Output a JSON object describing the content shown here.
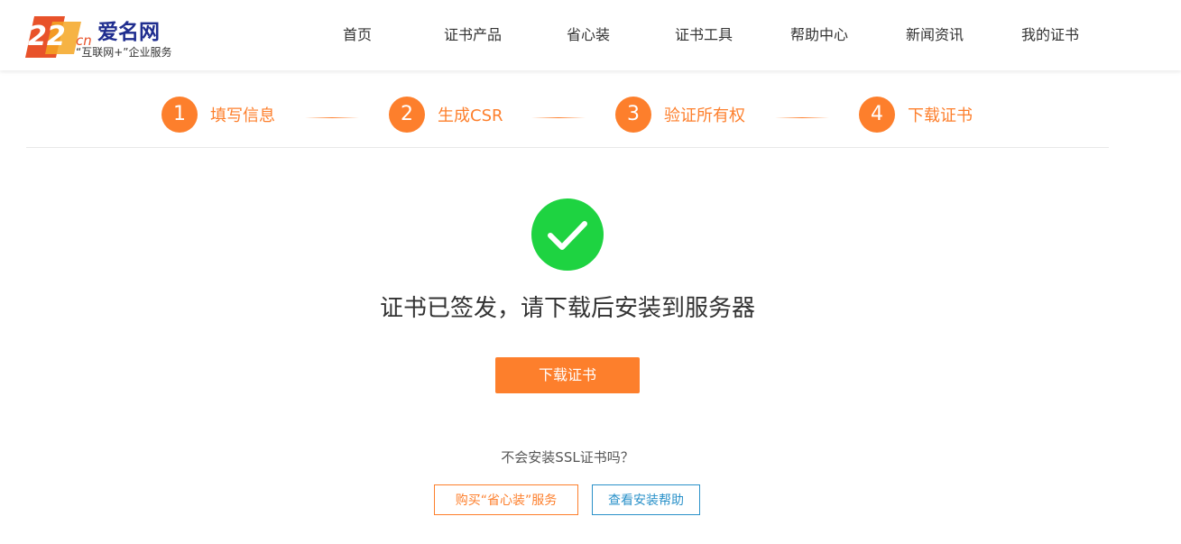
{
  "header": {
    "logo": {
      "mark_text": "22",
      "mark_suffix": "cn",
      "brand": "爱名网",
      "slogan": "“互联网+”企业服务"
    },
    "nav": [
      {
        "label": "首页"
      },
      {
        "label": "证书产品"
      },
      {
        "label": "省心装"
      },
      {
        "label": "证书工具"
      },
      {
        "label": "帮助中心"
      },
      {
        "label": "新闻资讯"
      },
      {
        "label": "我的证书"
      }
    ]
  },
  "steps": [
    {
      "number": "1",
      "label": "填写信息"
    },
    {
      "number": "2",
      "label": "生成CSR"
    },
    {
      "number": "3",
      "label": "验证所有权"
    },
    {
      "number": "4",
      "label": "下载证书"
    }
  ],
  "result": {
    "icon": "checkmark-icon",
    "title": "证书已签发，请下载后安装到服务器",
    "download_label": "下载证书",
    "question": "不会安装SSL证书吗？",
    "buy_service_label": "购买“省心装”服务",
    "help_label": "查看安装帮助"
  },
  "colors": {
    "accent": "#fd7f2c",
    "success": "#1ed341",
    "brand": "#1f2d8f",
    "link": "#2a91c9"
  }
}
